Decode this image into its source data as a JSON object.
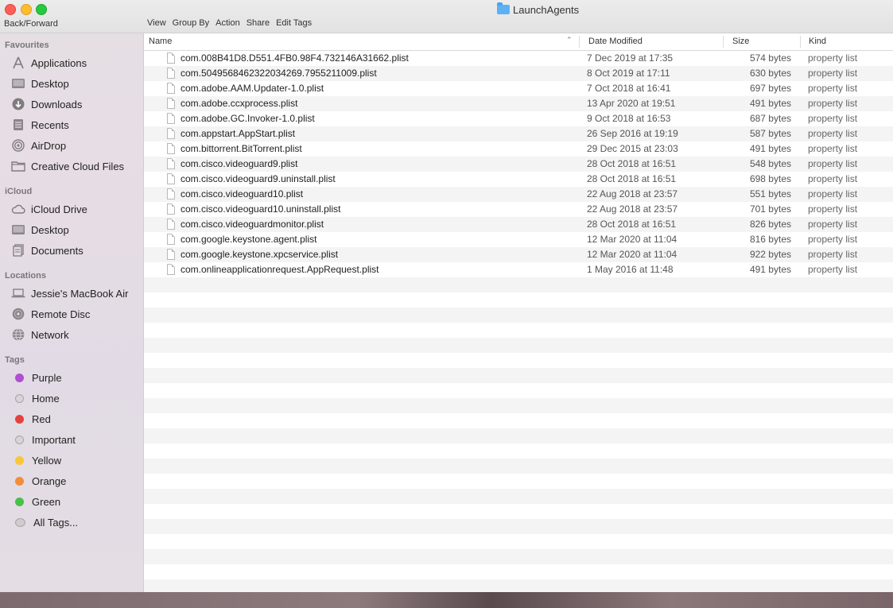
{
  "window": {
    "title": "LaunchAgents"
  },
  "toolbar": {
    "back_forward": "Back/Forward",
    "items": [
      "View",
      "Group By",
      "Action",
      "Share",
      "Edit Tags"
    ]
  },
  "sidebar": {
    "favourites_label": "Favourites",
    "favourites": [
      "Applications",
      "Desktop",
      "Downloads",
      "Recents",
      "AirDrop",
      "Creative Cloud Files"
    ],
    "icloud_label": "iCloud",
    "icloud": [
      "iCloud Drive",
      "Desktop",
      "Documents"
    ],
    "locations_label": "Locations",
    "locations": [
      "Jessie's MacBook Air",
      "Remote Disc",
      "Network"
    ],
    "tags_label": "Tags",
    "tags": [
      "Purple",
      "Home",
      "Red",
      "Important",
      "Yellow",
      "Orange",
      "Green",
      "All Tags..."
    ]
  },
  "columns": {
    "name": "Name",
    "date": "Date Modified",
    "size": "Size",
    "kind": "Kind"
  },
  "files": [
    {
      "name": "com.008B41D8.D551.4FB0.98F4.732146A31662.plist",
      "date": "7 Dec 2019 at 17:35",
      "size": "574 bytes",
      "kind": "property list"
    },
    {
      "name": "com.5049568462322034269.7955211009.plist",
      "date": "8 Oct 2019 at 17:11",
      "size": "630 bytes",
      "kind": "property list"
    },
    {
      "name": "com.adobe.AAM.Updater-1.0.plist",
      "date": "7 Oct 2018 at 16:41",
      "size": "697 bytes",
      "kind": "property list"
    },
    {
      "name": "com.adobe.ccxprocess.plist",
      "date": "13 Apr 2020 at 19:51",
      "size": "491 bytes",
      "kind": "property list"
    },
    {
      "name": "com.adobe.GC.Invoker-1.0.plist",
      "date": "9 Oct 2018 at 16:53",
      "size": "687 bytes",
      "kind": "property list"
    },
    {
      "name": "com.appstart.AppStart.plist",
      "date": "26 Sep 2016 at 19:19",
      "size": "587 bytes",
      "kind": "property list"
    },
    {
      "name": "com.bittorrent.BitTorrent.plist",
      "date": "29 Dec 2015 at 23:03",
      "size": "491 bytes",
      "kind": "property list"
    },
    {
      "name": "com.cisco.videoguard9.plist",
      "date": "28 Oct 2018 at 16:51",
      "size": "548 bytes",
      "kind": "property list"
    },
    {
      "name": "com.cisco.videoguard9.uninstall.plist",
      "date": "28 Oct 2018 at 16:51",
      "size": "698 bytes",
      "kind": "property list"
    },
    {
      "name": "com.cisco.videoguard10.plist",
      "date": "22 Aug 2018 at 23:57",
      "size": "551 bytes",
      "kind": "property list"
    },
    {
      "name": "com.cisco.videoguard10.uninstall.plist",
      "date": "22 Aug 2018 at 23:57",
      "size": "701 bytes",
      "kind": "property list"
    },
    {
      "name": "com.cisco.videoguardmonitor.plist",
      "date": "28 Oct 2018 at 16:51",
      "size": "826 bytes",
      "kind": "property list"
    },
    {
      "name": "com.google.keystone.agent.plist",
      "date": "12 Mar 2020 at 11:04",
      "size": "816 bytes",
      "kind": "property list"
    },
    {
      "name": "com.google.keystone.xpcservice.plist",
      "date": "12 Mar 2020 at 11:04",
      "size": "922 bytes",
      "kind": "property list"
    },
    {
      "name": "com.onlineapplicationrequest.AppRequest.plist",
      "date": "1 May 2016 at 11:48",
      "size": "491 bytes",
      "kind": "property list"
    }
  ],
  "colors": {
    "close": "#fe5f57",
    "minimize": "#febc2e",
    "maximize": "#28c840",
    "tag_purple": "#b04fd2",
    "tag_red": "#e6423d",
    "tag_yellow": "#f7c737",
    "tag_orange": "#f38d39",
    "tag_green": "#47c146",
    "tag_gray": "#cfcfcf"
  }
}
